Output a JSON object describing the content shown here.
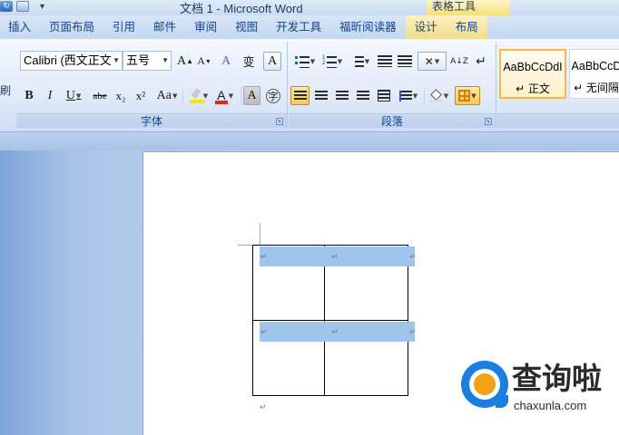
{
  "window": {
    "title": "文档 1 - Microsoft Word",
    "context_title": "表格工具",
    "qat_more": "▾"
  },
  "tabs": [
    {
      "label": "插入"
    },
    {
      "label": "页面布局"
    },
    {
      "label": "引用"
    },
    {
      "label": "邮件"
    },
    {
      "label": "审阅"
    },
    {
      "label": "视图"
    },
    {
      "label": "开发工具"
    },
    {
      "label": "福昕阅读器"
    },
    {
      "label": "设计"
    },
    {
      "label": "布局"
    }
  ],
  "clipboard": {
    "format_painter_label": "刷"
  },
  "font_group": {
    "label": "字体",
    "font_name": "Calibri (西文正文",
    "font_size": "五号",
    "grow": "A",
    "shrink": "A",
    "clear": "A",
    "phonetic": "变",
    "border_char": "A",
    "bold": "B",
    "italic": "I",
    "underline": "U",
    "strike": "abe",
    "subscript": "x₂",
    "superscript": "x²",
    "change_case": "Aa",
    "font_color": "A",
    "shading_char": "A",
    "enclose": "字",
    "highlight_color": "#f5e50a",
    "font_color_value": "#e2261c"
  },
  "paragraph_group": {
    "label": "段落",
    "sort": "A↓Z",
    "show_marks": "↵"
  },
  "styles": {
    "items": [
      {
        "sample": "AaBbCcDdI",
        "name": "↵ 正文"
      },
      {
        "sample": "AaBbCcD",
        "name": "↵ 无间隔"
      }
    ]
  },
  "document": {
    "cell_mark": "↵",
    "row_end_mark": "↵",
    "paragraph_mark": "↵"
  },
  "watermark": {
    "brand": "查询啦",
    "url": "chaxunla.com"
  }
}
